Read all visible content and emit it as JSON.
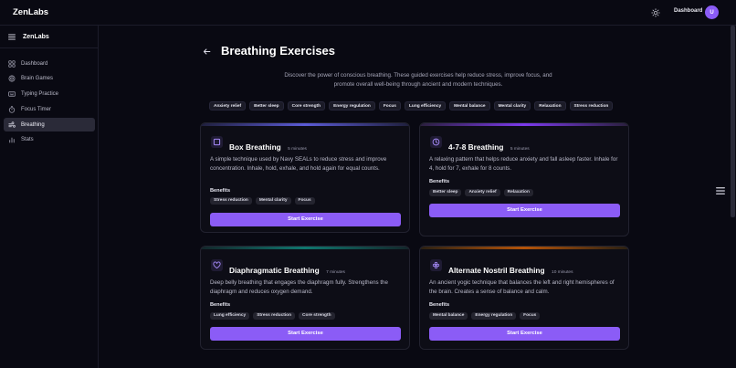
{
  "header": {
    "brand": "ZenLabs",
    "nav_dashboard": "Dashboard",
    "avatar_initial": "U"
  },
  "sidebar": {
    "title": "ZenLabs",
    "items": [
      {
        "label": "Dashboard",
        "icon": "grid-icon"
      },
      {
        "label": "Brain Games",
        "icon": "brain-icon"
      },
      {
        "label": "Typing Practice",
        "icon": "keyboard-icon"
      },
      {
        "label": "Focus Timer",
        "icon": "timer-icon"
      },
      {
        "label": "Breathing",
        "icon": "wind-icon",
        "active": true
      },
      {
        "label": "Stats",
        "icon": "bar-chart-icon"
      }
    ]
  },
  "main": {
    "title": "Breathing Exercises",
    "intro": "Discover the power of conscious breathing. These guided exercises help reduce stress, improve focus, and promote overall well-being through ancient and modern techniques.",
    "tags": [
      "Anxiety relief",
      "Better sleep",
      "Core strength",
      "Energy regulation",
      "Focus",
      "Lung efficiency",
      "Mental balance",
      "Mental clarity",
      "Relaxation",
      "Stress reduction"
    ],
    "benefits_label": "Benefits",
    "start_label": "Start Exercise",
    "cards": [
      {
        "title": "Box Breathing",
        "duration": "5 minutes",
        "description": "A simple technique used by Navy SEALs to reduce stress and improve concentration. Inhale, hold, exhale, and hold again for equal counts.",
        "benefits": [
          "Stress reduction",
          "Mental clarity",
          "Focus"
        ],
        "icon": "square-icon",
        "accent": "#5b5bd6"
      },
      {
        "title": "4-7-8 Breathing",
        "duration": "5 minutes",
        "description": "A relaxing pattern that helps reduce anxiety and fall asleep faster. Inhale for 4, hold for 7, exhale for 8 counts.",
        "benefits": [
          "Better sleep",
          "Anxiety relief",
          "Relaxation"
        ],
        "icon": "clock-icon",
        "accent": "#7c3aed"
      },
      {
        "title": "Diaphragmatic Breathing",
        "duration": "7 minutes",
        "description": "Deep belly breathing that engages the diaphragm fully. Strengthens the diaphragm and reduces oxygen demand.",
        "benefits": [
          "Lung efficiency",
          "Stress reduction",
          "Core strength"
        ],
        "icon": "heart-icon",
        "accent": "#0f766e"
      },
      {
        "title": "Alternate Nostril Breathing",
        "duration": "10 minutes",
        "description": "An ancient yogic technique that balances the left and right hemispheres of the brain. Creates a sense of balance and calm.",
        "benefits": [
          "Mental balance",
          "Energy regulation",
          "Focus"
        ],
        "icon": "flower-icon",
        "accent": "#b45309"
      }
    ]
  },
  "colors": {
    "accent": "#8b5cf6",
    "background": "#090912",
    "card": "#0d0d16"
  }
}
